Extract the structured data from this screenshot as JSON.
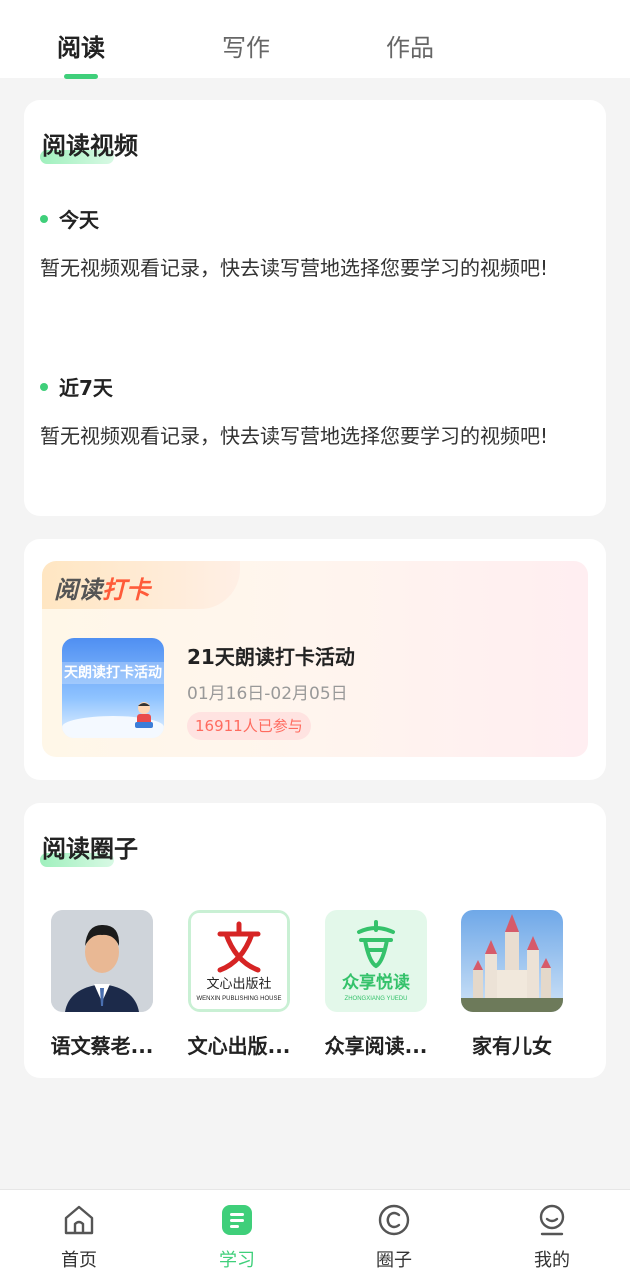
{
  "top_tabs": [
    {
      "label": "阅读",
      "active": true
    },
    {
      "label": "写作",
      "active": false
    },
    {
      "label": "作品",
      "active": false
    }
  ],
  "video_section": {
    "title": "阅读视频",
    "groups": [
      {
        "label": "今天",
        "empty_text": "暂无视频观看记录，快去读写营地选择您要学习的视频吧!"
      },
      {
        "label": "近7天",
        "empty_text": "暂无视频观看记录，快去读写营地选择您要学习的视频吧!"
      }
    ]
  },
  "checkin_section": {
    "tag_part1": "阅读",
    "tag_part2": "打卡",
    "thumb_text": "天朗读打卡活动",
    "activity_title": "21天朗读打卡活动",
    "date_range": "01月16日-02月05日",
    "participants": "16911人已参与"
  },
  "circle_section": {
    "title": "阅读圈子",
    "items": [
      {
        "name": "语文蔡老...",
        "icon": "person-avatar"
      },
      {
        "name": "文心出版...",
        "icon": "wenxin-publishing-logo"
      },
      {
        "name": "众享阅读...",
        "icon": "zhongxiang-yuedu-logo"
      },
      {
        "name": "家有儿女",
        "icon": "castle-image"
      }
    ]
  },
  "bottom_nav": [
    {
      "label": "首页",
      "icon": "home-icon",
      "active": false
    },
    {
      "label": "学习",
      "icon": "study-icon",
      "active": true
    },
    {
      "label": "圈子",
      "icon": "circle-icon",
      "active": false
    },
    {
      "label": "我的",
      "icon": "profile-icon",
      "active": false
    }
  ],
  "colors": {
    "accent": "#3fcf7a",
    "checkin_accent": "#ff5b3a",
    "background": "#f4f4f4"
  }
}
